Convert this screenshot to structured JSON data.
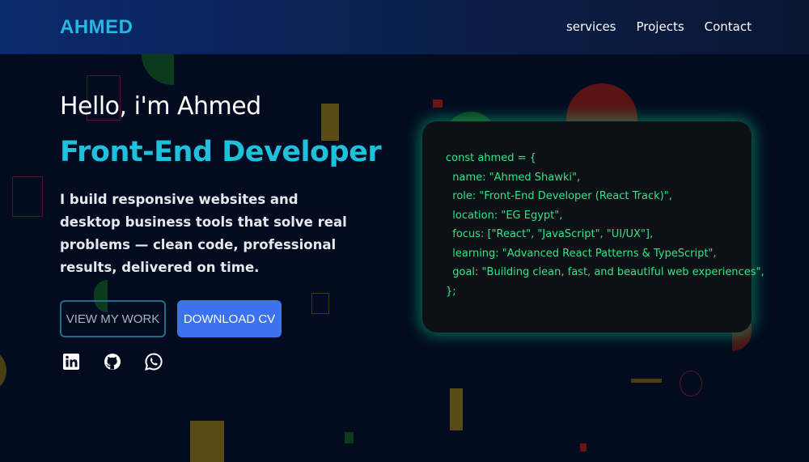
{
  "nav": {
    "logo": "AHMED",
    "links": [
      "services",
      "Projects",
      "Contact"
    ]
  },
  "hero": {
    "greeting": "Hello, i'm Ahmed",
    "role": "Front-End Developer",
    "description": "I build responsive websites and desktop business tools that solve real problems — clean code, professional results, delivered on time.",
    "buttons": {
      "view_work": "VIEW MY WORK",
      "download_cv": "DOWNLOAD CV"
    },
    "social_icons": [
      "linkedin-icon",
      "github-icon",
      "whatsapp-icon"
    ]
  },
  "code_card": {
    "lines": [
      "const ahmed = {",
      "  name: \"Ahmed Shawki\",",
      "  role: \"Front-End Developer (React Track)\",",
      "  location: \"EG Egypt\",",
      "  focus: [\"React\", \"JavaScript\", \"UI/UX\"],",
      "  learning: \"Advanced React Patterns & TypeScript\",",
      "  goal: \"Building clean, fast, and beautiful web experiences\",",
      "};"
    ]
  },
  "colors": {
    "background": "#020b1f",
    "accent_cyan": "#1fc0dc",
    "button_blue": "#3b72f0",
    "code_green": "#2ee68a"
  }
}
